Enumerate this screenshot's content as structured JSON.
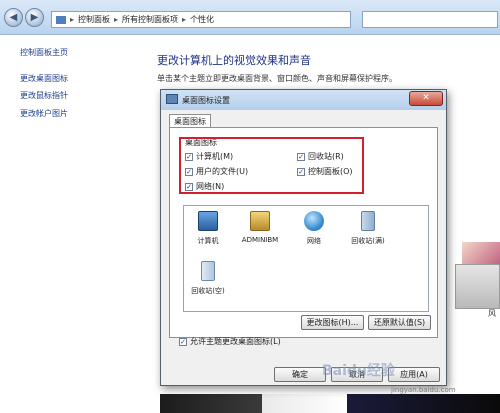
{
  "breadcrumb": {
    "items": [
      "控制面板",
      "所有控制面板项",
      "个性化"
    ],
    "separator": "▸"
  },
  "sidebar": {
    "items": [
      {
        "label": "控制面板主页"
      },
      {
        "label": "更改桌面图标"
      },
      {
        "label": "更改鼠标指针"
      },
      {
        "label": "更改帐户图片"
      }
    ]
  },
  "main": {
    "heading": "更改计算机上的视觉效果和声音",
    "description": "单击某个主题立即更改桌面背景、窗口颜色、声音和屏幕保护程序。",
    "side_letter": "风"
  },
  "dialog": {
    "title": "桌面图标设置",
    "close_glyph": "✕",
    "tab_label": "桌面图标",
    "group_label": "桌面图标",
    "checkboxes": [
      {
        "label": "计算机(M)",
        "checked": true
      },
      {
        "label": "回收站(R)",
        "checked": true
      },
      {
        "label": "用户的文件(U)",
        "checked": true
      },
      {
        "label": "控制面板(O)",
        "checked": true
      },
      {
        "label": "网络(N)",
        "checked": true
      }
    ],
    "icons": [
      {
        "label": "计算机",
        "icon": "computer-icon",
        "color": "#4a86c8"
      },
      {
        "label": "ADMINIBM",
        "icon": "user-folder-icon",
        "color": "#d8b14a"
      },
      {
        "label": "网络",
        "icon": "network-icon",
        "color": "#3d8fd1"
      },
      {
        "label": "回收站(满)",
        "icon": "recycle-bin-full-icon",
        "color": "#9db8d4"
      },
      {
        "label": "回收站(空)",
        "icon": "recycle-bin-empty-icon",
        "color": "#b9cfe3"
      }
    ],
    "change_icon_button": "更改图标(H)...",
    "restore_default_button": "还原默认值(S)",
    "allow_theme_label": "允许主题更改桌面图标(L)",
    "allow_theme_checked": true,
    "ok_button": "确定",
    "cancel_button": "取消",
    "apply_button": "应用(A)"
  },
  "watermark": {
    "text": "Baidu经验",
    "url": "jingyan.baidu.com"
  },
  "colors": {
    "highlight": "#d2202e",
    "link": "#1e3d8c",
    "heading": "#1e3287"
  }
}
